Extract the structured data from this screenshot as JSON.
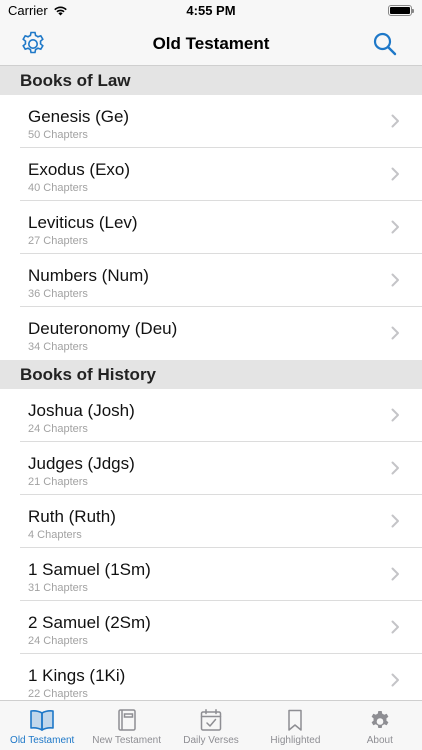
{
  "status": {
    "carrier": "Carrier",
    "time": "4:55 PM"
  },
  "nav": {
    "title": "Old Testament"
  },
  "sections": [
    {
      "header": "Books of Law",
      "rows": [
        {
          "title": "Genesis (Ge)",
          "subtitle": "50 Chapters"
        },
        {
          "title": "Exodus (Exo)",
          "subtitle": "40 Chapters"
        },
        {
          "title": "Leviticus (Lev)",
          "subtitle": "27 Chapters"
        },
        {
          "title": "Numbers (Num)",
          "subtitle": "36 Chapters"
        },
        {
          "title": "Deuteronomy (Deu)",
          "subtitle": "34 Chapters"
        }
      ]
    },
    {
      "header": "Books of History",
      "rows": [
        {
          "title": "Joshua (Josh)",
          "subtitle": "24 Chapters"
        },
        {
          "title": "Judges (Jdgs)",
          "subtitle": "21 Chapters"
        },
        {
          "title": "Ruth (Ruth)",
          "subtitle": "4 Chapters"
        },
        {
          "title": "1 Samuel (1Sm)",
          "subtitle": "31 Chapters"
        },
        {
          "title": "2 Samuel (2Sm)",
          "subtitle": "24 Chapters"
        },
        {
          "title": "1 Kings (1Ki)",
          "subtitle": "22 Chapters"
        }
      ]
    }
  ],
  "tabs": [
    {
      "label": "Old Testament",
      "icon": "book-open-icon"
    },
    {
      "label": "New Testament",
      "icon": "book-closed-icon"
    },
    {
      "label": "Daily Verses",
      "icon": "calendar-check-icon"
    },
    {
      "label": "Highlighted",
      "icon": "bookmark-icon"
    },
    {
      "label": "About",
      "icon": "gear-icon"
    }
  ],
  "colors": {
    "accent": "#1e78c8",
    "inactive": "#8e8e93",
    "section_bg": "#e4e4e4"
  }
}
